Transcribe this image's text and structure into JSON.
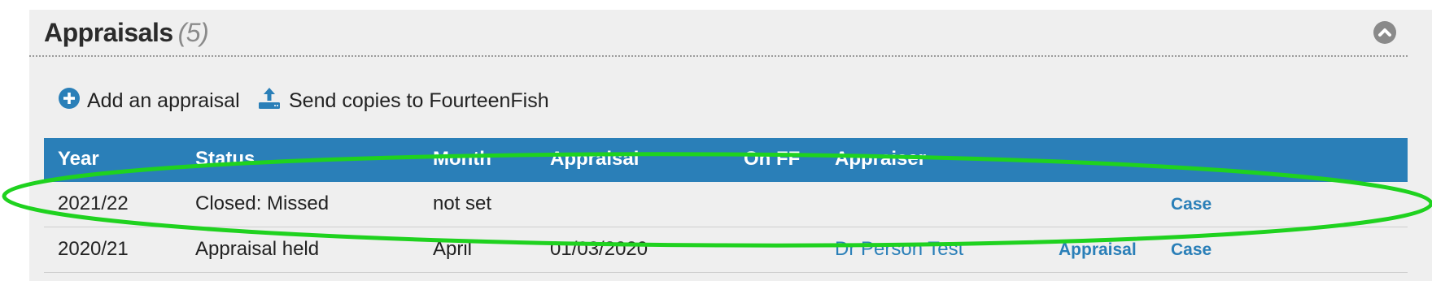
{
  "panel": {
    "title": "Appraisals",
    "count": "(5)"
  },
  "actions": {
    "add_label": "Add an appraisal",
    "send_label": "Send copies to FourteenFish"
  },
  "table": {
    "columns": [
      "Year",
      "Status",
      "Month",
      "Appraisal",
      "On FF",
      "Appraiser"
    ],
    "rows": [
      {
        "year": "2021/22",
        "status": "Closed: Missed",
        "month": "not set",
        "appraisal": "",
        "on_ff": "",
        "appraiser": "",
        "action_appraisal": "",
        "action_case": "Case"
      },
      {
        "year": "2020/21",
        "status": "Appraisal held",
        "month": "April",
        "appraisal": "01/03/2020",
        "on_ff": "",
        "appraiser": "Dr Person Test",
        "action_appraisal": "Appraisal",
        "action_case": "Case"
      }
    ]
  },
  "colors": {
    "header_blue": "#2a7fb8",
    "link_blue": "#2a7fb8",
    "panel_bg": "#efefef",
    "annotation_green": "#1fd21f"
  },
  "icons": {
    "add": "plus-circle-icon",
    "send": "upload-icon",
    "collapse": "chevron-up-icon"
  }
}
